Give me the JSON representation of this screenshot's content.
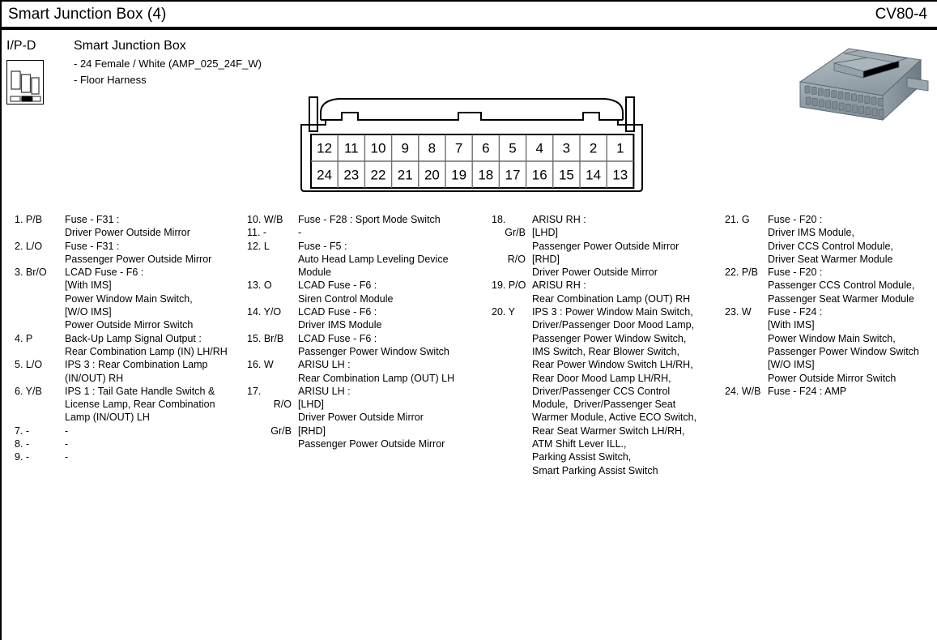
{
  "header": {
    "title": "Smart Junction Box (4)",
    "code": "CV80-4"
  },
  "info": {
    "location_label": "I/P-D",
    "connector_name": "Smart Junction Box",
    "spec_line": "- 24 Female / White (AMP_025_24F_W)",
    "harness_line": "- Floor Harness"
  },
  "connector_diagram": {
    "top_row": [
      "12",
      "11",
      "10",
      "9",
      "8",
      "7",
      "6",
      "5",
      "4",
      "3",
      "2",
      "1"
    ],
    "bottom_row": [
      "24",
      "23",
      "22",
      "21",
      "20",
      "19",
      "18",
      "17",
      "16",
      "15",
      "14",
      "13"
    ]
  },
  "pin_columns": [
    [
      {
        "key": "1. P/B",
        "desc": "Fuse - F31 :\nDriver Power Outside Mirror"
      },
      {
        "key": "2. L/O",
        "desc": "Fuse - F31 :\nPassenger Power Outside Mirror"
      },
      {
        "key": "3. Br/O",
        "desc": "LCAD Fuse - F6 :\n[With IMS]\nPower Window Main Switch,\n[W/O IMS]\nPower Outside Mirror Switch"
      },
      {
        "key": "4. P",
        "desc": "Back-Up Lamp Signal Output :\nRear Combination Lamp (IN) LH/RH"
      },
      {
        "key": "5. L/O",
        "desc": "IPS 3 : Rear Combination Lamp\n(IN/OUT) RH"
      },
      {
        "key": "6. Y/B",
        "desc": "IPS 1 : Tail Gate Handle Switch &\nLicense Lamp, Rear Combination\nLamp (IN/OUT) LH"
      },
      {
        "key": "7. -",
        "desc": "-"
      },
      {
        "key": "8. -",
        "desc": "-"
      },
      {
        "key": "9. -",
        "desc": "-"
      }
    ],
    [
      {
        "key": "10. W/B",
        "desc": "Fuse - F28 : Sport Mode Switch"
      },
      {
        "key": "11. -",
        "desc": "-"
      },
      {
        "key": "12. L",
        "desc": "Fuse - F5 :\nAuto Head Lamp Leveling Device\nModule"
      },
      {
        "key": "13. O",
        "desc": "LCAD Fuse - F6 :\nSiren Control Module"
      },
      {
        "key": "14. Y/O",
        "desc": "LCAD Fuse - F6 :\nDriver IMS Module"
      },
      {
        "key": "15. Br/B",
        "desc": "LCAD Fuse - F6 :\nPassenger Power Window Switch"
      },
      {
        "key": "16. W",
        "desc": "ARISU LH :\nRear Combination Lamp (OUT) LH"
      },
      {
        "key": "17.",
        "desc": "ARISU LH :"
      },
      {
        "key": "R/O",
        "indent": true,
        "desc": "[LHD]\nDriver Power Outside Mirror"
      },
      {
        "key": "Gr/B",
        "indent": true,
        "desc": "[RHD]\nPassenger Power Outside Mirror"
      }
    ],
    [
      {
        "key": "18.",
        "desc": "ARISU RH :"
      },
      {
        "key": "Gr/B",
        "indent": true,
        "desc": "[LHD]\nPassenger Power Outside Mirror"
      },
      {
        "key": "R/O",
        "indent": true,
        "desc": "[RHD]\nDriver Power Outside Mirror"
      },
      {
        "key": "19. P/O",
        "desc": "ARISU RH :\nRear Combination Lamp (OUT) RH"
      },
      {
        "key": "20. Y",
        "desc": "IPS 3 : Power Window Main Switch,\nDriver/Passenger Door Mood Lamp,\nPassenger Power Window Switch,\nIMS Switch, Rear Blower Switch,\nRear Power Window Switch LH/RH,\nRear Door Mood Lamp LH/RH,\nDriver/Passenger CCS Control\nModule,  Driver/Passenger Seat\nWarmer Module, Active ECO Switch,\nRear Seat Warmer Switch LH/RH,\nATM Shift Lever ILL.,\nParking Assist Switch,\nSmart Parking Assist Switch"
      }
    ],
    [
      {
        "key": "21. G",
        "desc": "Fuse - F20 :\nDriver IMS Module,\nDriver CCS Control Module,\nDriver Seat Warmer Module"
      },
      {
        "key": "22. P/B",
        "desc": "Fuse - F20 :\nPassenger CCS Control Module,\nPassenger Seat Warmer Module"
      },
      {
        "key": "23. W",
        "desc": "Fuse - F24 :\n[With IMS]\nPower Window Main Switch,\nPassenger Power Window Switch\n[W/O IMS]\nPower Outside Mirror Switch"
      },
      {
        "key": "24. W/B",
        "desc": "Fuse - F24 : AMP"
      }
    ]
  ]
}
